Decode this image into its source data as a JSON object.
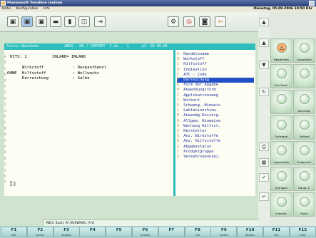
{
  "window": {
    "title": "Pharmasoft Trendline (online)"
  },
  "menu": [
    "Datei",
    "Konfiguration",
    "Info"
  ],
  "datetime": "Dienstag, 05.09.2006  10:50 Uhr",
  "toolbar": {
    "icons": [
      "monitor-1-icon",
      "monitor-2-icon",
      "monitor-3-icon",
      "monitor-4-icon",
      "tower-icon",
      "box-icon",
      "exit-icon",
      "gear-icon",
      "lifebuoy-icon",
      "camera-icon",
      "back-arrow-icon"
    ]
  },
  "screen": {
    "status_line": " Sietus-Apotheke            ABDA - DB / COMFORT  5.2a    1      p1  05.09.06",
    "hits_label": "HITS: 1",
    "inland_label": "INLAND= INLAND",
    "criteria": [
      {
        "prefix": "",
        "field": "Wirkstoff",
        "value": ": Dexpanthenol"
      },
      {
        "prefix": "OHNE",
        "field": "Hilfsstoff",
        "value": ": Wollwachs"
      },
      {
        "prefix": "",
        "field": "Darreichung",
        "value": ": Salbe"
      }
    ],
    "margin_letters": [
      "A",
      "B",
      "C",
      "D",
      "E",
      "F",
      "G",
      "H",
      "I",
      "J",
      "K",
      "L",
      "M",
      "N",
      "O",
      "P",
      "Q",
      "R",
      "S",
      "T",
      "U",
      "V"
    ],
    "side_items": [
      {
        "key": "A",
        "label": "Handelsname"
      },
      {
        "key": "B",
        "label": "Wirkstoff"
      },
      {
        "key": "C",
        "label": "Hilfsstoff"
      },
      {
        "key": "D",
        "label": "Indikation"
      },
      {
        "key": "E",
        "label": "ATC - Code"
      },
      {
        "key": "F",
        "label": "Darreichung"
      },
      {
        "key": "G",
        "label": "Form der Abgabe"
      },
      {
        "key": "H",
        "label": "Anwendungsform"
      },
      {
        "key": "I",
        "label": "Applikationsweg"
      },
      {
        "key": "J",
        "label": "Wirkort"
      },
      {
        "key": "K",
        "label": "Schwang.-Hinweis"
      },
      {
        "key": "L",
        "label": "Laktationshinw."
      },
      {
        "key": "M",
        "label": "Anwendg.Dosierg."
      },
      {
        "key": "N",
        "label": "Allgem. Hinweise"
      },
      {
        "key": "O",
        "label": "Warnung Hilfsst."
      },
      {
        "key": "P",
        "label": "Hersteller"
      },
      {
        "key": "Q",
        "label": "Anz. Wirkstoffe"
      },
      {
        "key": "R",
        "label": "Anz. Hilfsstoffe"
      },
      {
        "key": "S",
        "label": "Abgabestatus"
      },
      {
        "key": "T",
        "label": "Produktgruppe"
      },
      {
        "key": "U",
        "label": "Verkehrskennzei."
      }
    ],
    "selected_index": 5,
    "cursor": "[▯"
  },
  "bottom_status": "NEU: Scan, A/ AUSWAHL: A-U",
  "actions": [
    "Bearbeiten",
    "Auswählen",
    "Zus.Einst.",
    "",
    "",
    "Verknüpf.",
    "Sollstand",
    "Sollfest",
    "Lagerdaten",
    "Entspricht",
    "Anfragen",
    "Haupt.-F.",
    "Inland/A.",
    "Mono"
  ],
  "fkeys": [
    {
      "key": "F1",
      "sub": "Hilfe"
    },
    {
      "key": "F2",
      "sub": "Suchen"
    },
    {
      "key": "F3",
      "sub": "Ausgabe"
    },
    {
      "key": "F4",
      "sub": ""
    },
    {
      "key": "F5",
      "sub": ""
    },
    {
      "key": "F6",
      "sub": "Sonstige"
    },
    {
      "key": "F7",
      "sub": ""
    },
    {
      "key": "F8",
      "sub": "Info"
    },
    {
      "key": "F9",
      "sub": "Kunden"
    },
    {
      "key": "F10",
      "sub": "Bestand"
    },
    {
      "key": "F11",
      "sub": "Info"
    },
    {
      "key": "F12",
      "sub": "Ende"
    }
  ]
}
